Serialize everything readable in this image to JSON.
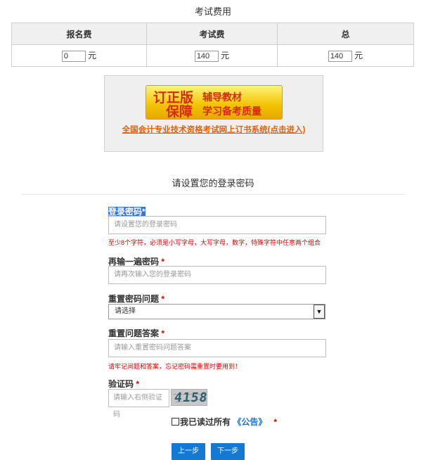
{
  "fee": {
    "title": "考试费用",
    "headers": [
      "报名费",
      "考试费",
      "总"
    ],
    "values": [
      "0",
      "140",
      "140"
    ],
    "unit": "元"
  },
  "banner": {
    "line1_big": "订正版",
    "line1_small": "辅导教材",
    "line2_big": "保障",
    "line2_small": "学习备考质量",
    "link": "全国会计专业技术资格考试网上订书系统(点击进入)"
  },
  "form": {
    "section_title": "请设置您的登录密码",
    "password": {
      "label": "登录密码",
      "required": "*",
      "placeholder": "请设置您的登录密码",
      "hint": "至少8个字符，必须是小写字母，大写字母，数字，特殊字符中任意两个组合"
    },
    "confirm": {
      "label": "再输一遍密码",
      "required": "*",
      "placeholder": "请再次输入您的登录密码"
    },
    "question": {
      "label": "重置密码问题",
      "required": "*",
      "selected": "请选择"
    },
    "answer": {
      "label": "重置问题答案",
      "required": "*",
      "placeholder": "请输入重置密码问题答案",
      "hint": "请牢记问题和答案，忘记密码需重置时要用到！"
    },
    "captcha": {
      "label": "验证码",
      "required": "*",
      "placeholder": "请输入右侧验证码",
      "code": "4158"
    },
    "agree": {
      "text": "我已读过所有",
      "link": "《公告》",
      "required": "*"
    },
    "buttons": {
      "prev": "上一步",
      "next": "下一步"
    }
  }
}
